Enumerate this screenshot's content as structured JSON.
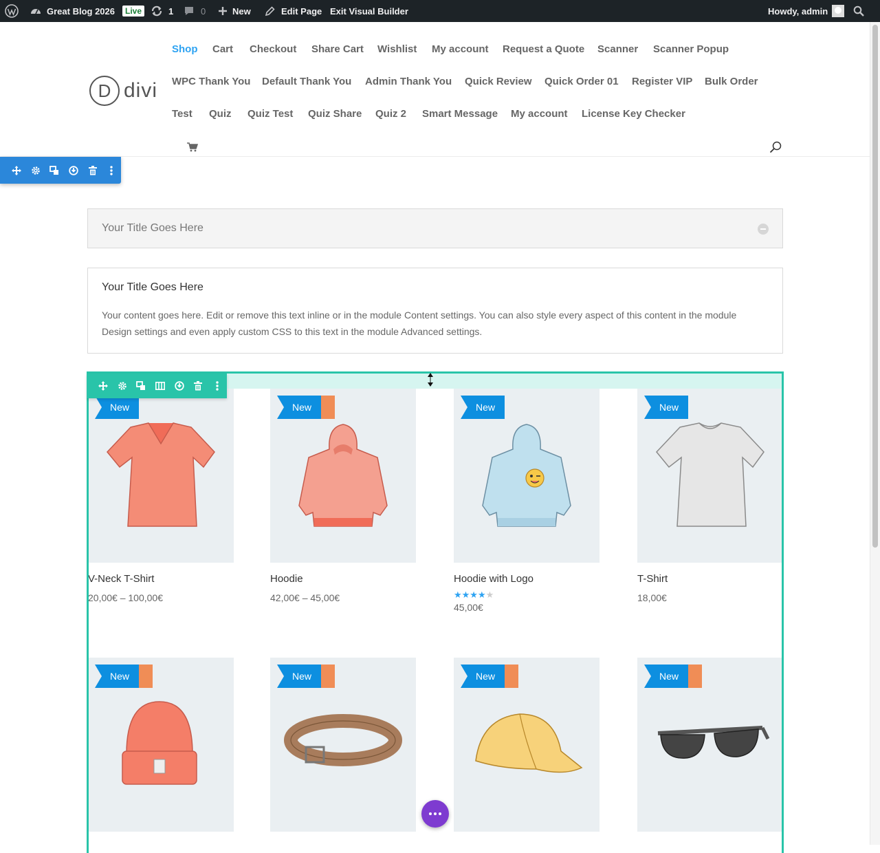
{
  "admin_bar": {
    "site_name": "Great Blog 2026",
    "live_badge": "Live",
    "updates_count": "1",
    "comments_count": "0",
    "new_label": "New",
    "edit_page": "Edit Page",
    "exit_builder": "Exit Visual Builder",
    "greeting": "Howdy, admin"
  },
  "header": {
    "logo_letter": "D",
    "logo_text": "divi",
    "nav": [
      "Shop",
      "Cart",
      "Checkout",
      "Share Cart",
      "Wishlist",
      "My account",
      "Request a Quote",
      "Scanner",
      "Scanner Popup",
      "WPC Thank You",
      "Default Thank You",
      "Admin Thank You",
      "Quick Review",
      "Quick Order 01",
      "Register VIP",
      "Bulk Order",
      "Test",
      "Quiz",
      "Quiz Test",
      "Quiz Share",
      "Quiz 2",
      "Smart Message",
      "My account",
      "License Key Checker"
    ],
    "active_item": "Shop"
  },
  "toggle": {
    "title": "Your Title Goes Here"
  },
  "text_box": {
    "title": "Your Title Goes Here",
    "content": "Your content goes here. Edit or remove this text inline or in the module Content settings. You can also style every aspect of this content in the module Design settings and even apply custom CSS to this text in the module Advanced settings."
  },
  "badge_label": "New",
  "products": [
    {
      "name": "V-Neck T-Shirt",
      "price": "20,00€ – 100,00€",
      "sale": false
    },
    {
      "name": "Hoodie",
      "price": "42,00€ – 45,00€",
      "sale": true
    },
    {
      "name": "Hoodie with Logo",
      "price": "45,00€",
      "rating": 4,
      "sale": false
    },
    {
      "name": "T-Shirt",
      "price": "18,00€",
      "sale": false
    },
    {
      "name": "",
      "price": "",
      "sale": true
    },
    {
      "name": "",
      "price": "",
      "sale": true
    },
    {
      "name": "",
      "price": "",
      "sale": true
    },
    {
      "name": "",
      "price": "",
      "sale": true
    }
  ],
  "colors": {
    "admin_bar": "#1d2327",
    "accent": "#2ea3f2",
    "section_toolbar": "#2b87da",
    "row_toolbar": "#29c4a9",
    "badge": "#0d8fe0",
    "sale_badge": "#f08d56",
    "fab": "#7e3bd0"
  }
}
